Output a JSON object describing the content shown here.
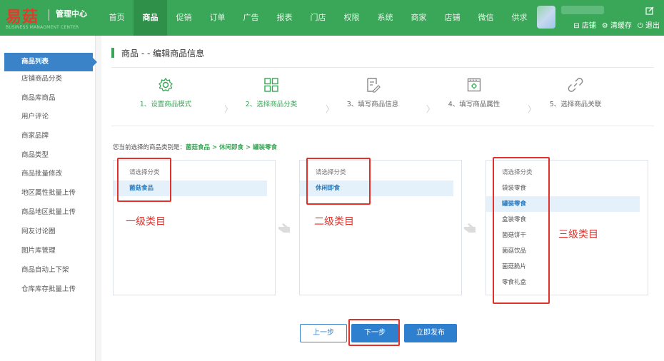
{
  "header": {
    "logo_text": "易菇",
    "logo_sub": "管理中心",
    "logo_en": "BUSINESS MANAGMENT CENTER",
    "nav": [
      "首页",
      "商品",
      "促销",
      "订单",
      "广告",
      "报表",
      "门店",
      "权限",
      "系统",
      "商家",
      "店铺",
      "微信",
      "供求"
    ],
    "active_nav": "商品",
    "actions": {
      "store": "⊟ 店铺",
      "clear_cache": "⚙ 清缓存",
      "logout": "⏻ 退出"
    },
    "colors": {
      "bar": "#3aa657",
      "logo": "#e23b2e"
    }
  },
  "sidebar": {
    "items": [
      {
        "label": "商品列表",
        "active": true
      },
      {
        "label": "店铺商品分类"
      },
      {
        "label": "商品库商品"
      },
      {
        "label": "用户评论"
      },
      {
        "label": "商家品牌"
      },
      {
        "label": "商品类型"
      },
      {
        "label": "商品批量修改"
      },
      {
        "label": "地区属性批量上传"
      },
      {
        "label": "商品地区批量上传"
      },
      {
        "label": "网友讨论圈"
      },
      {
        "label": "图片库管理"
      },
      {
        "label": "商品自动上下架"
      },
      {
        "label": "仓库库存批量上传"
      }
    ]
  },
  "main": {
    "title": "商品 - - 编辑商品信息",
    "steps": [
      {
        "label": "1、设置商品模式",
        "icon": "gear-icon",
        "done": true
      },
      {
        "label": "2、选择商品分类",
        "icon": "grid-icon",
        "done": true
      },
      {
        "label": "3、填写商品信息",
        "icon": "edit-doc-icon",
        "done": false
      },
      {
        "label": "4、填写商品属性",
        "icon": "attribute-icon",
        "done": false
      },
      {
        "label": "5、选择商品关联",
        "icon": "link-icon",
        "done": false
      }
    ],
    "step_arrow": "〉",
    "crumb_prefix": "您当前选择的商品类别是：",
    "crumb_path": "菌菇食品 > 休闲即食 > 罐装零食",
    "level1": {
      "placeholder": "请选择分类",
      "options": [
        "菌菇食品"
      ],
      "selected": "菌菇食品",
      "annotation": "一级类目"
    },
    "level2": {
      "placeholder": "请选择分类",
      "options": [
        "休闲即食"
      ],
      "selected": "休闲即食",
      "annotation": "二级类目"
    },
    "level3": {
      "placeholder": "请选择分类",
      "options": [
        "袋装零食",
        "罐装零食",
        "盒装零食",
        "菌菇饼干",
        "菌菇饮品",
        "菌菇脆片",
        "零食礼盒"
      ],
      "selected": "罐装零食",
      "annotation": "三级类目"
    },
    "buttons": {
      "prev": "上一步",
      "next": "下一步",
      "publish": "立即发布"
    },
    "colors": {
      "accent": "#3aa657",
      "button": "#2f7fcf",
      "annotation": "#e0312a",
      "selected_bg": "#e4f1fb"
    }
  }
}
